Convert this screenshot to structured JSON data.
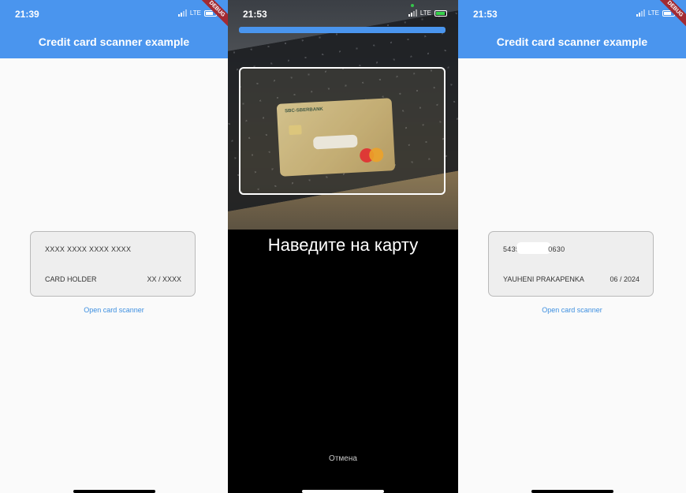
{
  "left_screen": {
    "status_time": "21:39",
    "network": "LTE",
    "app_title": "Credit card scanner example",
    "debug_label": "DEBUG",
    "card": {
      "number": "XXXX XXXX XXXX XXXX",
      "holder": "CARD HOLDER",
      "expiry": "XX / XXXX"
    },
    "open_scanner_label": "Open card scanner"
  },
  "scanner_screen": {
    "status_time": "21:53",
    "network": "LTE",
    "bank_name": "SBC-SBERBANK",
    "hint": "Наведите на карту",
    "cancel_label": "Отмена"
  },
  "right_screen": {
    "status_time": "21:53",
    "network": "LTE",
    "app_title": "Credit card scanner example",
    "debug_label": "DEBUG",
    "card": {
      "number_prefix": "5435",
      "number_suffix": "0630",
      "holder": "YAUHENI PRAKAPENKA",
      "expiry": "06 / 2024"
    },
    "open_scanner_label": "Open card scanner"
  },
  "colors": {
    "appbar": "#4a95ee",
    "link": "#3d8fe0",
    "debug_ribbon": "#a22a32"
  }
}
